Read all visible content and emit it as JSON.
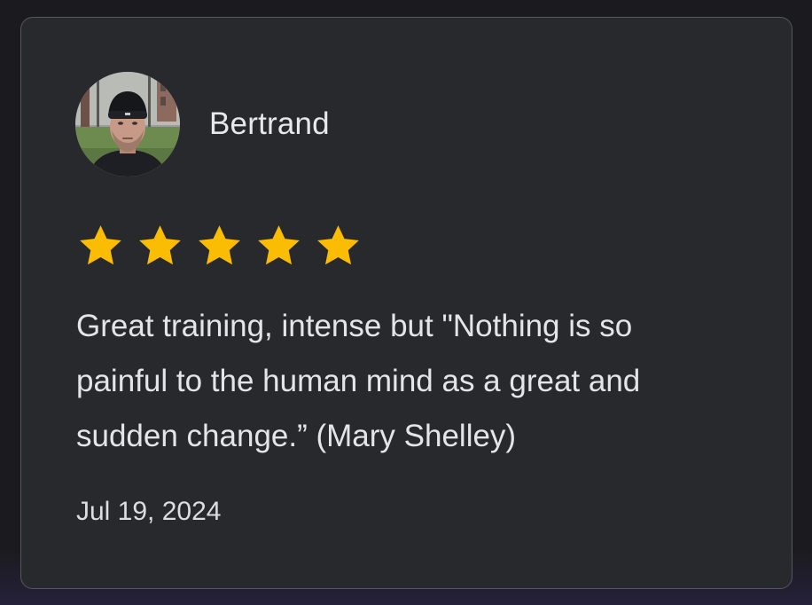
{
  "review_card": {
    "reviewer_name": "Bertrand",
    "rating": 5,
    "max_rating": 5,
    "review_text": "Great training, intense but \"Nothing is so painful to the human mind as a great and sudden change.” (Mary Shelley)",
    "date": "Jul 19, 2024"
  },
  "icons": {
    "avatar": "avatar-photo",
    "star": "star-icon"
  },
  "colors": {
    "page_background": "#1b1b1f",
    "card_background": "#28292d",
    "card_border": "#55575e",
    "star": "#fbbc04",
    "text": "#e4e5ea"
  }
}
